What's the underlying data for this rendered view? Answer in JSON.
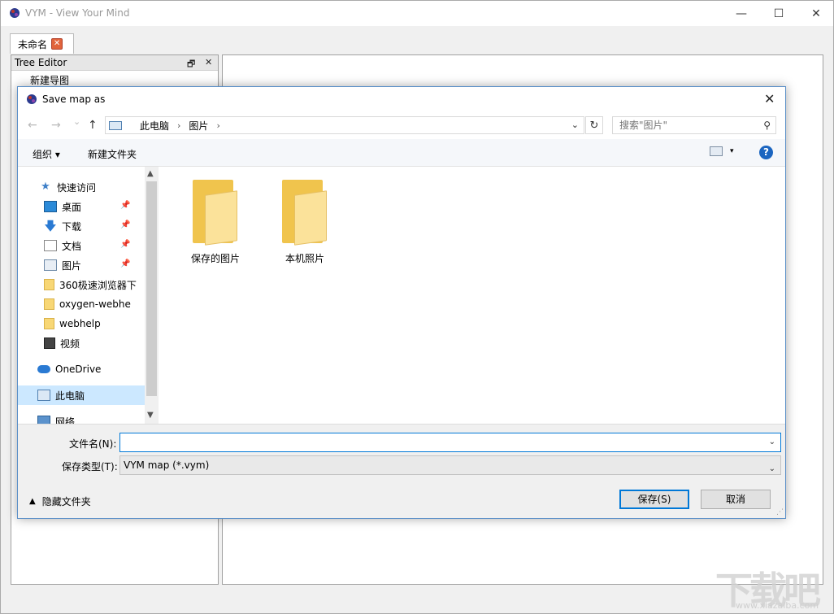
{
  "window": {
    "title": "VYM - View Your Mind",
    "controls": {
      "minimize": "—",
      "maximize": "☐",
      "close": "✕"
    }
  },
  "tab": {
    "label": "未命名",
    "close_icon": "✕"
  },
  "tree_editor": {
    "title": "Tree Editor",
    "float_icon": "🗗",
    "close_icon": "✕",
    "root_item": "新建导图"
  },
  "dialog": {
    "title": "Save map as",
    "close_icon": "✕",
    "nav": {
      "back": "←",
      "forward": "→",
      "recent": "⌄",
      "up": "↑"
    },
    "address": {
      "segments": [
        "此电脑",
        "图片"
      ],
      "separator": "›",
      "dropdown": "⌄",
      "refresh": "↻"
    },
    "search": {
      "placeholder": "搜索\"图片\"",
      "icon": "⚲"
    },
    "toolbar": {
      "organize": "组织 ▾",
      "new_folder": "新建文件夹",
      "view_dropdown": "▾",
      "help": "?"
    },
    "nav_pane": {
      "items": [
        {
          "label": "快速访问",
          "icon": "star-icon"
        },
        {
          "label": "桌面",
          "icon": "desktop-icon",
          "pinned": true
        },
        {
          "label": "下载",
          "icon": "download-icon",
          "pinned": true
        },
        {
          "label": "文档",
          "icon": "document-icon",
          "pinned": true
        },
        {
          "label": "图片",
          "icon": "pictures-icon",
          "pinned": true
        },
        {
          "label": "360极速浏览器下",
          "icon": "folder-icon"
        },
        {
          "label": "oxygen-webhe",
          "icon": "folder-icon"
        },
        {
          "label": "webhelp",
          "icon": "folder-icon"
        },
        {
          "label": "视频",
          "icon": "video-icon"
        },
        {
          "label": "OneDrive",
          "icon": "onedrive-icon"
        },
        {
          "label": "此电脑",
          "icon": "computer-icon",
          "selected": true
        },
        {
          "label": "网络",
          "icon": "network-icon"
        }
      ],
      "pin_glyph": "📌",
      "scroll_up": "▲",
      "scroll_down": "▼"
    },
    "files": [
      {
        "label": "保存的图片"
      },
      {
        "label": "本机照片"
      }
    ],
    "filename": {
      "label": "文件名(N):",
      "value": "",
      "dropdown": "⌄"
    },
    "filetype": {
      "label": "保存类型(T):",
      "value": "VYM map (*.vym)",
      "dropdown": "⌄"
    },
    "hide_folders": {
      "chevron": "▲",
      "label": "隐藏文件夹"
    },
    "buttons": {
      "save": "保存(S)",
      "cancel": "取消"
    },
    "grip": "⋰"
  },
  "watermark": {
    "text": "下载吧",
    "url": "www.xiazaiba.com"
  }
}
